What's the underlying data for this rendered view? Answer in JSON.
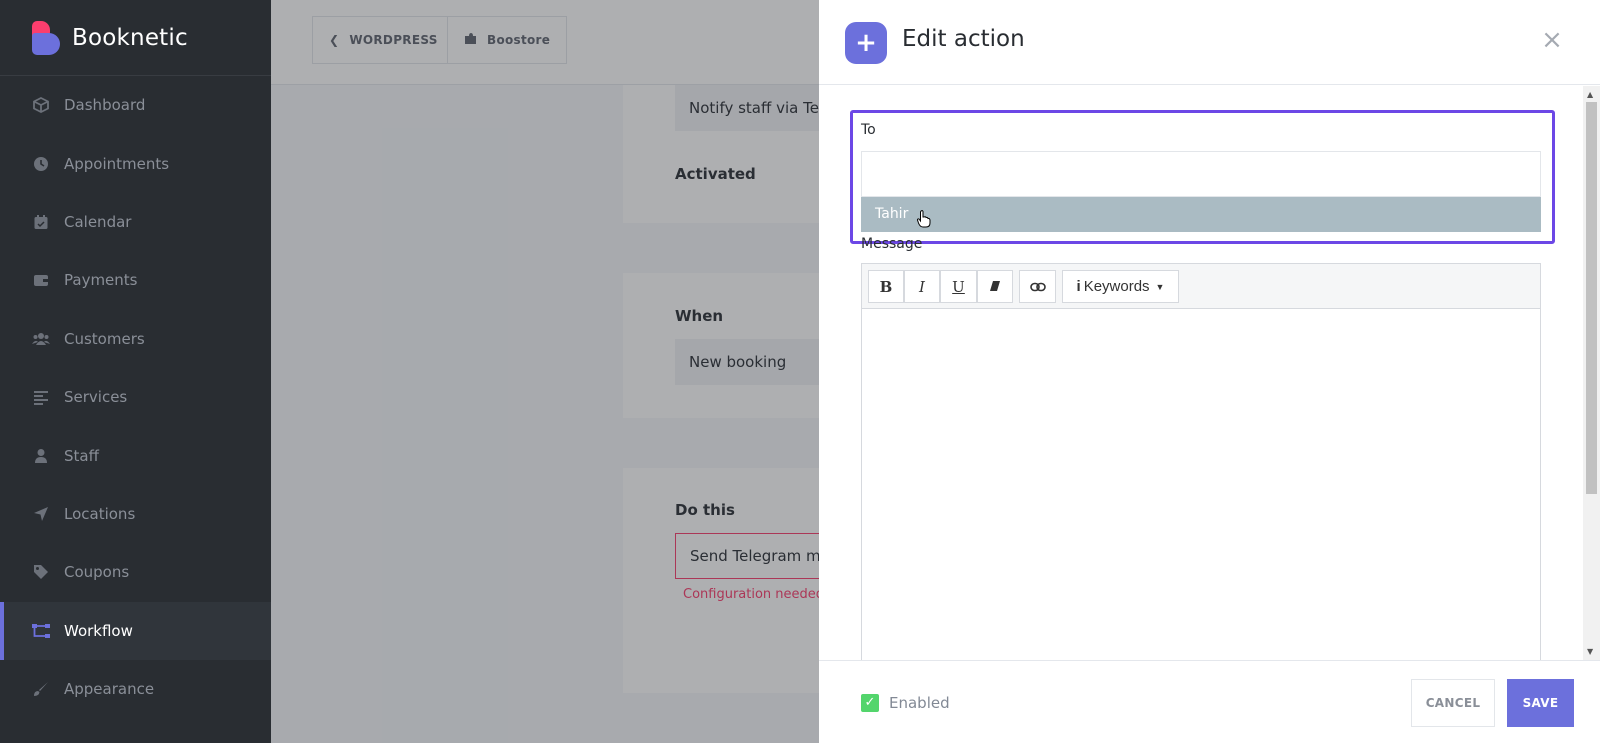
{
  "app": {
    "name": "Booknetic"
  },
  "sidebar": {
    "items": [
      {
        "label": "Dashboard",
        "icon": "dashboard-icon",
        "active": false
      },
      {
        "label": "Appointments",
        "icon": "clock-icon",
        "active": false
      },
      {
        "label": "Calendar",
        "icon": "calendar-icon",
        "active": false
      },
      {
        "label": "Payments",
        "icon": "wallet-icon",
        "active": false
      },
      {
        "label": "Customers",
        "icon": "users-icon",
        "active": false
      },
      {
        "label": "Services",
        "icon": "list-icon",
        "active": false
      },
      {
        "label": "Staff",
        "icon": "user-icon",
        "active": false
      },
      {
        "label": "Locations",
        "icon": "location-arrow-icon",
        "active": false
      },
      {
        "label": "Coupons",
        "icon": "tag-icon",
        "active": false
      },
      {
        "label": "Workflow",
        "icon": "workflow-icon",
        "active": true
      },
      {
        "label": "Appearance",
        "icon": "brush-icon",
        "active": false
      }
    ]
  },
  "topbar": {
    "wordpress_label": "WORDPRESS",
    "boostore_label": "Boostore"
  },
  "background": {
    "workflow_name": "Notify staff via Tele",
    "activated_label": "Activated",
    "when_label": "When",
    "when_value": "New booking",
    "do_this_label": "Do this",
    "do_this_value": "Send Telegram m",
    "config_error": "Configuration needed"
  },
  "drawer": {
    "title": "Edit action",
    "to_label": "To",
    "to_input_value": "",
    "dropdown_option": "Tahir",
    "message_label": "Message",
    "toolbar": {
      "bold": "B",
      "italic": "I",
      "underline": "U",
      "keywords_label": "Keywords"
    },
    "enabled_label": "Enabled",
    "enabled_checked": true,
    "cancel_label": "CANCEL",
    "save_label": "SAVE"
  },
  "colors": {
    "accent": "#6c70dc",
    "sidebar_bg": "#292d32",
    "error": "#fb3e6e",
    "check": "#53d56c",
    "highlight_border": "#6c47e6"
  }
}
